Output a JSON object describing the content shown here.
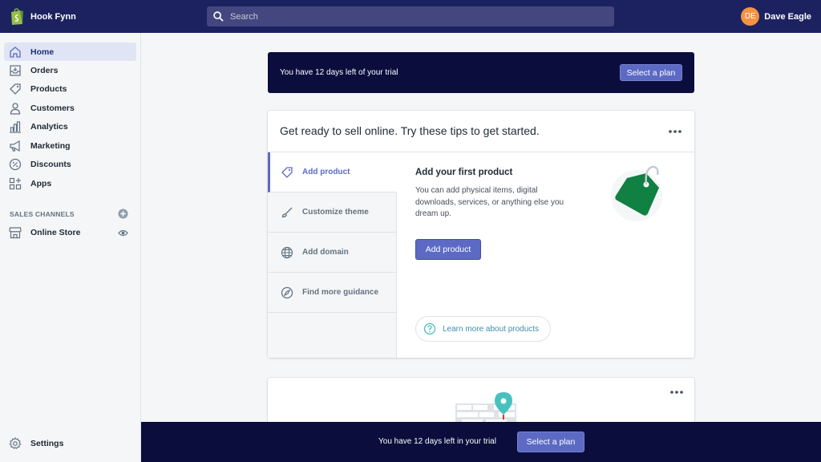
{
  "topbar": {
    "store_name": "Hook Fynn",
    "search_placeholder": "Search",
    "user_initials": "DE",
    "user_name": "Dave Eagle"
  },
  "sidebar": {
    "items": [
      {
        "label": "Home",
        "icon": "home-icon",
        "active": true
      },
      {
        "label": "Orders",
        "icon": "orders-icon"
      },
      {
        "label": "Products",
        "icon": "tag-icon"
      },
      {
        "label": "Customers",
        "icon": "person-icon"
      },
      {
        "label": "Analytics",
        "icon": "bar-chart-icon"
      },
      {
        "label": "Marketing",
        "icon": "megaphone-icon"
      },
      {
        "label": "Discounts",
        "icon": "discount-icon"
      },
      {
        "label": "Apps",
        "icon": "apps-icon"
      }
    ],
    "sales_channels_title": "SALES CHANNELS",
    "online_store_label": "Online Store",
    "settings_label": "Settings"
  },
  "trial_banner": {
    "text": "You have 12 days left of your trial",
    "button": "Select a plan"
  },
  "tips_card": {
    "title": "Get ready to sell online. Try these tips to get started.",
    "tips": [
      {
        "label": "Add product",
        "icon": "tag-icon",
        "active": true
      },
      {
        "label": "Customize theme",
        "icon": "brush-icon"
      },
      {
        "label": "Add domain",
        "icon": "globe-icon"
      },
      {
        "label": "Find more guidance",
        "icon": "compass-icon"
      }
    ],
    "detail": {
      "title": "Add your first product",
      "description": "You can add physical items, digital downloads, services, or anything else you dream up.",
      "button": "Add product",
      "learn_more": "Learn more about products"
    }
  },
  "bottom_banner": {
    "text": "You have 12 days left in your trial",
    "button": "Select a plan"
  },
  "colors": {
    "topbar": "#1c2260",
    "banner": "#0b0e3c",
    "accent": "#5c6ac4",
    "tag_green": "#108043",
    "avatar": "#f49342"
  }
}
